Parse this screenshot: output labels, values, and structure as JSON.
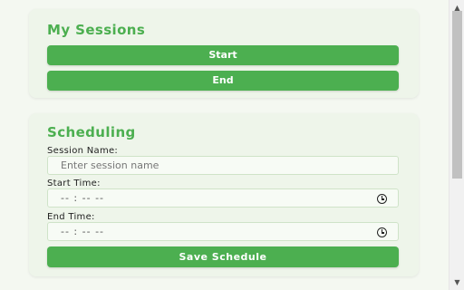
{
  "sessions": {
    "title": "My Sessions",
    "start_label": "Start",
    "end_label": "End"
  },
  "scheduling": {
    "title": "Scheduling",
    "session_name_label": "Session Name:",
    "session_name_placeholder": "Enter session name",
    "start_time_label": "Start Time:",
    "start_time_value": "-- : --   --",
    "end_time_label": "End Time:",
    "end_time_value": "-- : --   --",
    "save_label": "Save Schedule"
  },
  "colors": {
    "accent": "#4caf50",
    "card_bg": "#eef5ea",
    "page_bg": "#f4f8f1"
  },
  "icons": {
    "clock": "clock-icon",
    "scroll_up": "triangle-up",
    "scroll_down": "triangle-down"
  }
}
